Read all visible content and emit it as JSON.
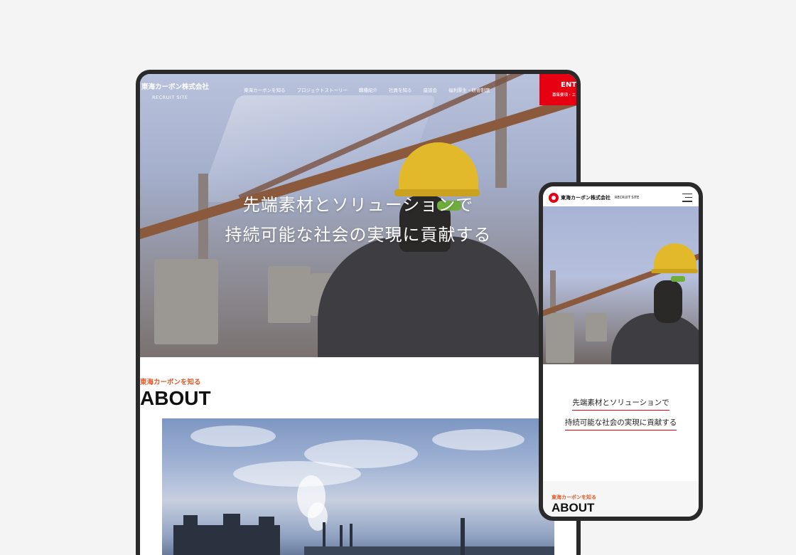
{
  "tablet": {
    "nav": {
      "logo": "東海カーボン株式会社",
      "logo_sub": "RECRUIT SITE",
      "links": [
        "東海カーボンを知る",
        "プロジェクトストーリー",
        "職種紹介",
        "社員を知る",
        "座談会",
        "福利厚生・研修制度"
      ],
      "entry_title": "ENTRY",
      "entry_sub": "募集要項・エントリー"
    },
    "hero": {
      "line1": "先端素材とソリューションで",
      "line2": "持続可能な社会の実現に貢献する"
    },
    "about": {
      "eyebrow": "東海カーボンを知る",
      "title": "ABOUT"
    }
  },
  "phone": {
    "header": {
      "logo": "東海カーボン株式会社",
      "recruit": "RECRUIT SITE"
    },
    "copy": {
      "line1": "先端素材とソリューションで",
      "line2": "持続可能な社会の実現に貢献する"
    },
    "about": {
      "eyebrow": "東海カーボンを知る",
      "title": "ABOUT"
    }
  },
  "colors": {
    "accent_red": "#e60012",
    "eyebrow_orange": "#e05a2a",
    "device_frame": "#2a2a2a",
    "background": "#f4f4f4"
  }
}
